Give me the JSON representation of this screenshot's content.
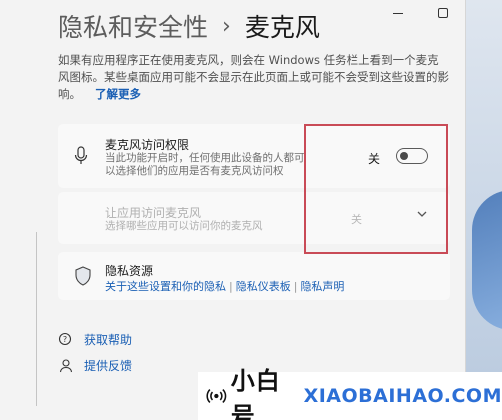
{
  "window": {
    "breadcrumb_parent": "隐私和安全性",
    "breadcrumb_sep": "›",
    "breadcrumb_current": "麦克风"
  },
  "description": {
    "text": "如果有应用程序正在使用麦克风，则会在 Windows 任务栏上看到一个麦克风图标。某些桌面应用可能不会显示在此页面上或可能不会受到这些设置的影响。",
    "learn_more": "了解更多"
  },
  "mic_access": {
    "title": "麦克风访问权限",
    "subtitle": "当此功能开启时，任何使用此设备的人都可以选择他们的应用是否有麦克风访问权",
    "toggle_label": "关",
    "toggle_on": false
  },
  "app_access": {
    "title": "让应用访问麦克风",
    "subtitle": "选择哪些应用可以访问你的麦克风",
    "state_label": "关"
  },
  "privacy": {
    "title": "隐私资源",
    "links": [
      "关于这些设置和你的隐私",
      "隐私仪表板",
      "隐私声明"
    ]
  },
  "footer": {
    "help": "获取帮助",
    "feedback": "提供反馈"
  },
  "watermark": {
    "brand_cn": "小白号",
    "brand_en": "XIAOBAIHAO.COM"
  }
}
